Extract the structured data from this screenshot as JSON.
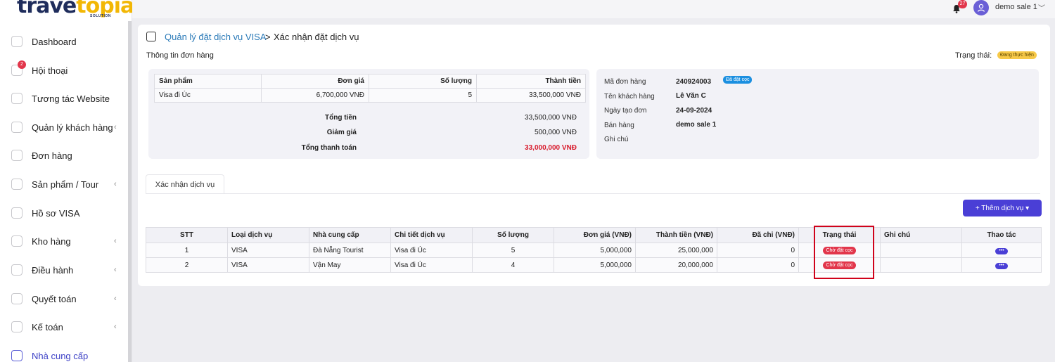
{
  "app": {
    "logo_part1": "trave",
    "logo_part2": "topia",
    "logo_sub": "SOLUTION"
  },
  "sidebar": {
    "items": [
      {
        "label": "Dashboard",
        "chevron": ""
      },
      {
        "label": "Hội thoại",
        "chevron": "",
        "badge": "2"
      },
      {
        "label": "Tương tác Website",
        "chevron": ""
      },
      {
        "label": "Quản lý khách hàng",
        "chevron": "‹"
      },
      {
        "label": "Đơn hàng",
        "chevron": ""
      },
      {
        "label": "Sản phẩm / Tour",
        "chevron": "‹"
      },
      {
        "label": "Hồ sơ VISA",
        "chevron": ""
      },
      {
        "label": "Kho hàng",
        "chevron": "‹"
      },
      {
        "label": "Điều hành",
        "chevron": "‹"
      },
      {
        "label": "Quyết toán",
        "chevron": "‹"
      },
      {
        "label": "Kế toán",
        "chevron": "‹"
      },
      {
        "label": "Nhà cung cấp",
        "chevron": ""
      }
    ]
  },
  "topbar": {
    "notification_count": "27",
    "user_name": "demo sale 1",
    "user_chevron": "﹀"
  },
  "breadcrumb": {
    "parent": "Quản lý đặt dịch vụ VISA",
    "separator": ">",
    "current": "Xác nhận đặt dịch vụ"
  },
  "order": {
    "section_title": "Thông tin đơn hàng",
    "status_label": "Trạng thái:",
    "status_value": "Đang thực hiện",
    "product_table": {
      "headers": [
        "Sản phẩm",
        "Đơn giá",
        "Số lượng",
        "Thành tiền"
      ],
      "rows": [
        [
          "Visa đi Úc",
          "6,700,000 VNĐ",
          "5",
          "33,500,000 VNĐ"
        ]
      ]
    },
    "totals": {
      "total_label": "Tổng tiền",
      "total_value": "33,500,000 VNĐ",
      "discount_label": "Giảm giá",
      "discount_value": "500,000 VNĐ",
      "payable_label": "Tổng thanh toán",
      "payable_value": "33,000,000 VNĐ"
    },
    "info": {
      "code_label": "Mã đơn hàng",
      "code_value": "240924003",
      "code_badge": "Đã đặt cọc",
      "customer_label": "Tên khách hàng",
      "customer_value": "Lê Văn C",
      "date_label": "Ngày tạo đơn",
      "date_value": "24-09-2024",
      "seller_label": "Bán hàng",
      "seller_value": "demo sale 1",
      "note_label": "Ghi chú",
      "note_value": ""
    }
  },
  "services": {
    "tab_label": "Xác nhận dịch vụ",
    "add_button": "+ Thêm dịch vụ ▾",
    "headers": [
      "STT",
      "Loại dịch vụ",
      "Nhà cung cấp",
      "Chi tiết dịch vụ",
      "Số lượng",
      "Đơn giá (VNĐ)",
      "Thành tiền (VNĐ)",
      "Đã chi (VNĐ)",
      "Trạng thái",
      "Ghi chú",
      "Thao tác"
    ],
    "rows": [
      {
        "stt": "1",
        "type": "VISA",
        "supplier": "Đà Nẵng Tourist",
        "detail": "Visa đi Úc",
        "qty": "5",
        "unit_price": "5,000,000",
        "amount": "25,000,000",
        "paid": "0",
        "status": "Chờ đặt cọc",
        "note": "",
        "action": "•••"
      },
      {
        "stt": "2",
        "type": "VISA",
        "supplier": "Vận May",
        "detail": "Visa đi Úc",
        "qty": "4",
        "unit_price": "5,000,000",
        "amount": "20,000,000",
        "paid": "0",
        "status": "Chờ đặt cọc",
        "note": "",
        "action": "•••"
      }
    ]
  },
  "colors": {
    "accent": "#4a3fd6",
    "link": "#2a7ab8",
    "danger": "#e2364b",
    "highlight": "#d0021b",
    "warning": "#f7c948"
  }
}
